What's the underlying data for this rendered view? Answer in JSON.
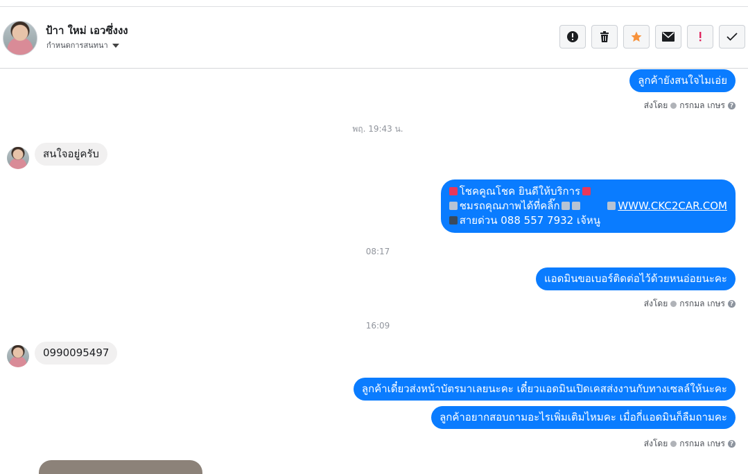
{
  "header": {
    "contact_name": "ป้าา ใหม่ เอวซึ่งงง",
    "conversation_label": "กำหนดการสนทนา"
  },
  "messages": {
    "m1": "ลูกค้ายังสนใจไมเอ่ย",
    "sent_by_label": "ส่งโดย",
    "sender_name": "กรกมล เกษร",
    "time1": "พฤ. 19:43 น.",
    "m2": "สนใจอยู่ครับ",
    "m3_line1": "โชคคูณโชค ยินดีให้บริการ",
    "m3_line2": "ชมรถคุณภาพได้ที่คลิ๊ก",
    "m3_link": "WWW.CKC2CAR.COM",
    "m3_line3": "สายด่วน 088 557 7932 เจ้หนู",
    "time2": "08:17",
    "m4": "แอดมินขอเบอร์ติดต่อไว้ด้วยหนอ่อยนะคะ",
    "time3": "16:09",
    "m5": "0990095497",
    "m6": "ลูกค้าเดี๋ยวส่งหน้าบัตรมาเลยนะคะ  เดี๋ยวแอดมินเปิดเคสส่งงานกับทางเซลล์ให้นะคะ",
    "m7": "ลูกค้าอยากสอบถามอะไรเพิ่มเติมไหมคะ เมื่อกี่แอดมินก็ลืมถามคะ"
  },
  "colors": {
    "outgoing_bubble": "#0a7cff",
    "incoming_bubble": "#f1f0f0",
    "star": "#f7923b",
    "alert": "#e0245e"
  },
  "icons": [
    "info-icon",
    "trash-icon",
    "star-icon",
    "envelope-icon",
    "exclamation-icon",
    "checkmark-icon"
  ]
}
